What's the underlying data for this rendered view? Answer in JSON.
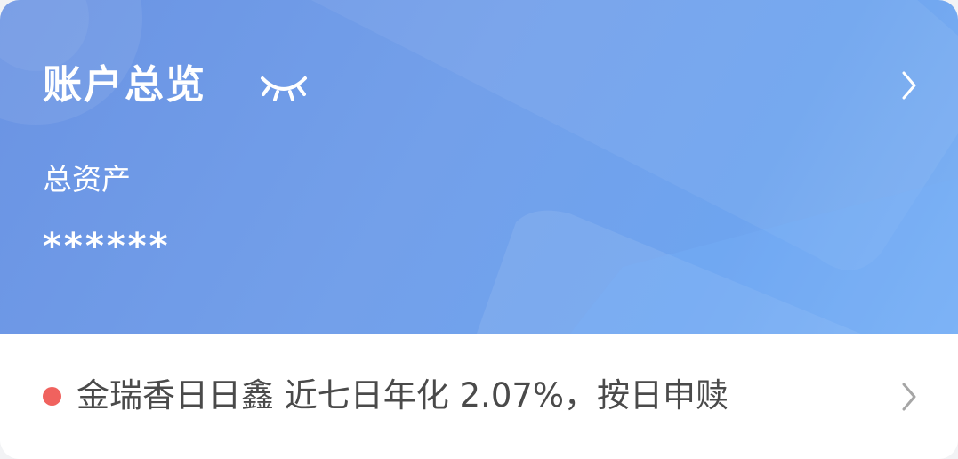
{
  "account_overview": {
    "title": "账户总览",
    "total_assets_label": "总资产",
    "total_assets_value": "******",
    "visibility_state": "hidden",
    "eye_icon": "closed-eye-icon",
    "arrow_icon": "chevron-right-icon"
  },
  "promo": {
    "text": "金瑞香日日鑫 近七日年化 2.07%，按日申赎",
    "dot_color": "#f0625e",
    "arrow_icon": "chevron-right-icon"
  },
  "colors": {
    "hero_gradient_start": "#6a93e3",
    "hero_gradient_end": "#7fb3f4",
    "promo_text": "#4a4a4a"
  }
}
